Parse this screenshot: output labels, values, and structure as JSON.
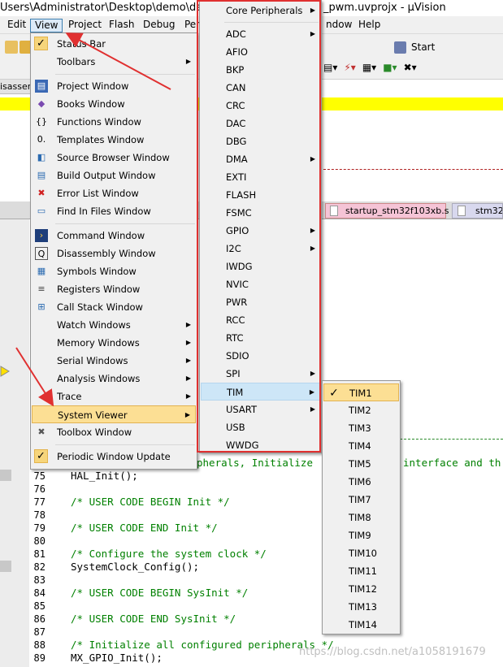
{
  "title": {
    "path": "Users\\Administrator\\Desktop\\demo\\dem",
    "suffix": "_pwm.uvprojx - µVision"
  },
  "menubar": [
    "Edit",
    "View",
    "Project",
    "Flash",
    "Debug",
    "Peri",
    "ndow",
    "Help"
  ],
  "toolbar": {
    "start_label": "Start",
    "disasm_tab": "isassem"
  },
  "view_menu": {
    "status_bar": "Status Bar",
    "toolbars": "Toolbars",
    "project_window": "Project Window",
    "books_window": "Books Window",
    "functions_window": "Functions Window",
    "templates_window": "Templates Window",
    "source_browser_window": "Source Browser Window",
    "build_output_window": "Build Output Window",
    "error_list_window": "Error List Window",
    "find_in_files_window": "Find In Files Window",
    "command_window": "Command Window",
    "disassembly_window": "Disassembly Window",
    "symbols_window": "Symbols Window",
    "registers_window": "Registers Window",
    "call_stack_window": "Call Stack Window",
    "watch_windows": "Watch Windows",
    "memory_windows": "Memory Windows",
    "serial_windows": "Serial Windows",
    "analysis_windows": "Analysis Windows",
    "trace": "Trace",
    "system_viewer": "System Viewer",
    "toolbox_window": "Toolbox Window",
    "periodic_window_update": "Periodic Window Update"
  },
  "system_viewer_menu": [
    "Core Peripherals",
    "ADC",
    "AFIO",
    "BKP",
    "CAN",
    "CRC",
    "DAC",
    "DBG",
    "DMA",
    "EXTI",
    "FLASH",
    "FSMC",
    "GPIO",
    "I2C",
    "IWDG",
    "NVIC",
    "PWR",
    "RCC",
    "RTC",
    "SDIO",
    "SPI",
    "TIM",
    "USART",
    "USB",
    "WWDG"
  ],
  "tim_menu": [
    "TIM1",
    "TIM2",
    "TIM3",
    "TIM4",
    "TIM5",
    "TIM6",
    "TIM7",
    "TIM8",
    "TIM9",
    "TIM10",
    "TIM11",
    "TIM12",
    "TIM13",
    "TIM14"
  ],
  "tabs": {
    "startup": "startup_stm32f103xb.s",
    "stm32": "stm32f"
  },
  "line_numbers": [
    "75",
    "76",
    "77",
    "78",
    "79",
    "80",
    "81",
    "82",
    "83",
    "84",
    "85",
    "86",
    "87",
    "88",
    "89"
  ],
  "code": {
    "line74_part1": "pherals, Initialize",
    "line74_part2": "interface and th",
    "line75": "HAL_Init();",
    "line77": "/* USER CODE BEGIN Init */",
    "line79": "/* USER CODE END Init */",
    "line81": "/* Configure the system clock */",
    "line82": "SystemClock_Config();",
    "line84": "/* USER CODE BEGIN SysInit */",
    "line86": "/* USER CODE END SysInit */",
    "line88": "/* Initialize all configured peripherals */",
    "line89": "MX_GPIO_Init();"
  },
  "watermark": "https://blog.csdn.net/a1058191679",
  "colors": {
    "highlight_orange": "#fcdf94",
    "red_box": "#e03030",
    "comment_green": "#008000"
  }
}
